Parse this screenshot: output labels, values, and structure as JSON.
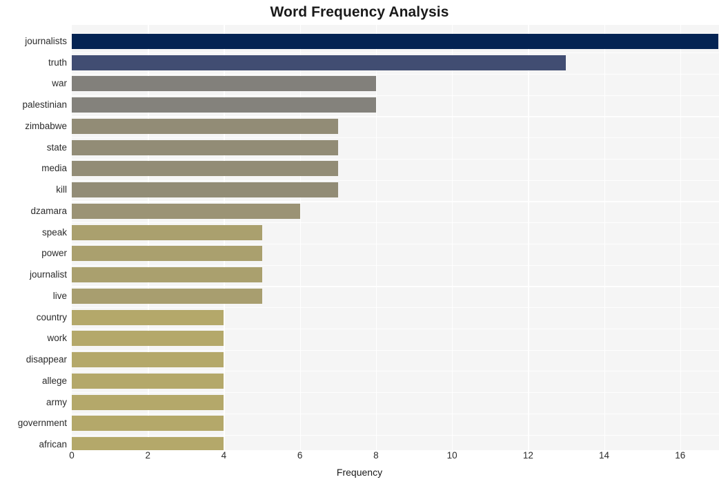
{
  "chart_data": {
    "type": "bar",
    "orientation": "horizontal",
    "title": "Word Frequency Analysis",
    "xlabel": "Frequency",
    "ylabel": "",
    "categories": [
      "journalists",
      "truth",
      "war",
      "palestinian",
      "zimbabwe",
      "state",
      "media",
      "kill",
      "dzamara",
      "speak",
      "power",
      "journalist",
      "live",
      "country",
      "work",
      "disappear",
      "allege",
      "army",
      "government",
      "african"
    ],
    "values": [
      17,
      13,
      8,
      8,
      7,
      7,
      7,
      7,
      6,
      5,
      5,
      5,
      5,
      4,
      4,
      4,
      4,
      4,
      4,
      4
    ],
    "bar_colors": [
      "#042353",
      "#414d72",
      "#82807b",
      "#84827c",
      "#928c76",
      "#928c76",
      "#928c76",
      "#928c76",
      "#9b9375",
      "#aaa06e",
      "#aaa06e",
      "#aaa06e",
      "#a89e6f",
      "#b4a86a",
      "#b4a86a",
      "#b4a86a",
      "#b4a86a",
      "#b4a86a",
      "#b4a86a",
      "#b4a86a"
    ],
    "xticks": [
      0,
      2,
      4,
      6,
      8,
      10,
      12,
      14,
      16
    ],
    "xlim": [
      0,
      17.02
    ],
    "grid": "vertical-white",
    "plot_background": "#f5f5f5",
    "figure_background": "#ffffff",
    "legend": null
  }
}
